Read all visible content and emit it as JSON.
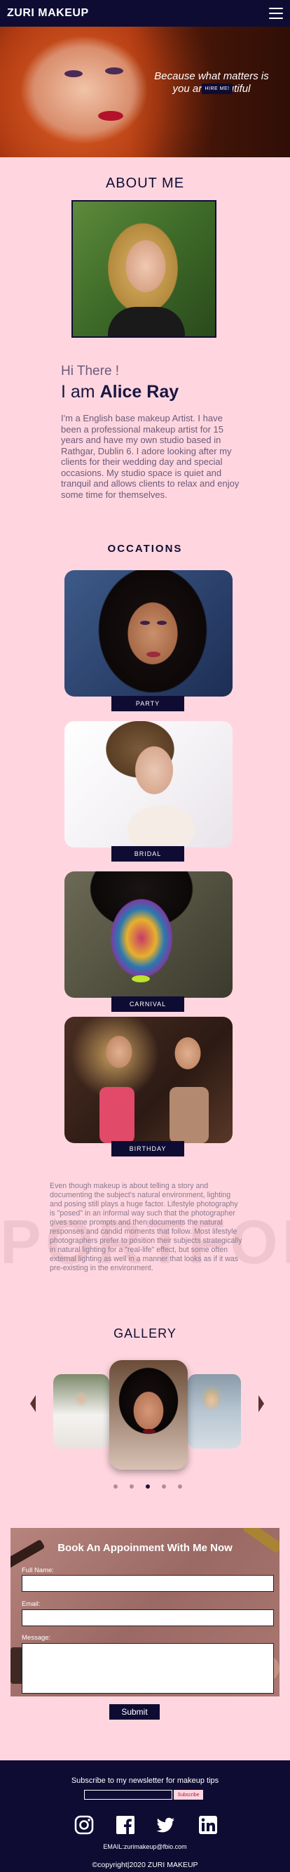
{
  "nav": {
    "brand": "ZURI MAKEUP",
    "menu_icon": "hamburger-icon"
  },
  "hero": {
    "tagline_line1": "Because what matters is",
    "tagline_line2": "you are beautiful",
    "cta": "HIRE ME!"
  },
  "about": {
    "title": "ABOUT ME",
    "greeting": "Hi There !",
    "name_prefix": "I am ",
    "name": "Alice Ray",
    "text": "I'm a English base makeup Artist. I have been a professional makeup artist for 15 years and have my own studio based in Rathgar, Dublin 6. I adore looking after my clients for their wedding day and special occasions. My studio space is quiet and tranquil and allows clients to relax and enjoy some time for themselves."
  },
  "occasions": {
    "title": "OCCATIONS",
    "items": [
      {
        "label": "PARTY"
      },
      {
        "label": "BRIDAL"
      },
      {
        "label": "CARNIVAL"
      },
      {
        "label": "BIRTHDAY"
      }
    ],
    "watermark": "PORTFOLIO",
    "story": "Even though makeup is about telling a story and documenting the subject's natural environment, lighting and posing still plays a huge factor. Lifestyle photography is \"posed\" in an informal way such that the photographer gives some prompts and then documents the natural responses and candid moments that follow. Most lifestyle photographers prefer to position their subjects strategically in natural lighting for a \"real-life\" effect, but some often external lighting as well in a manner that looks as if it was pre-existing in the environment."
  },
  "gallery": {
    "title": "GALLERY",
    "slide_count": 5,
    "active_slide": 3
  },
  "appointment": {
    "title": "Book An Appoinment With Me Now",
    "fullname_label": "Full Name:",
    "email_label": "Email:",
    "message_label": "Message:",
    "submit": "Submit"
  },
  "footer": {
    "newsletter_text": "Subscribe to my newsletter for makeup tips",
    "subscribe": "Subscribe",
    "social": [
      "instagram-icon",
      "facebook-icon",
      "twitter-icon",
      "linkedin-icon"
    ],
    "email": "EMAIL:zurimakeup@fbio.com",
    "copyright": "©copyright|2020 ZURI MAKEUP"
  },
  "colors": {
    "navy": "#0f0c34",
    "pink_bg": "#ffd6df"
  }
}
